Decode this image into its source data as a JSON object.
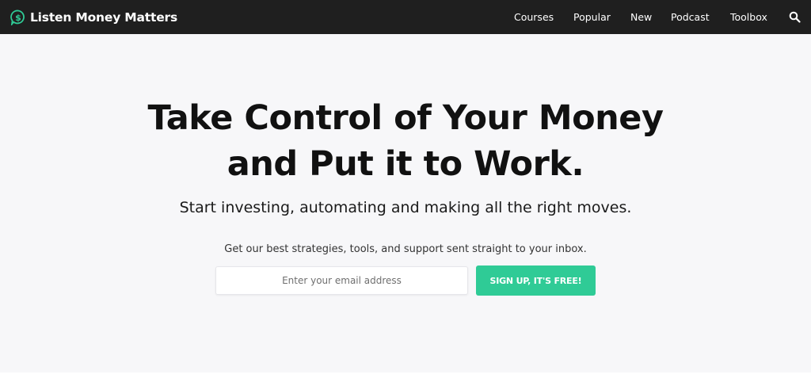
{
  "brand": {
    "name": "Listen Money Matters",
    "accent_color": "#2fcb96",
    "icon": "dollar-chat-bubble-icon"
  },
  "nav": {
    "items": [
      {
        "label": "Courses"
      },
      {
        "label": "Popular"
      },
      {
        "label": "New"
      },
      {
        "label": "Podcast"
      },
      {
        "label": "Toolbox"
      }
    ],
    "search_icon": "search-icon"
  },
  "hero": {
    "headline_line1": "Take Control of Your Money",
    "headline_line2": "and Put it to Work.",
    "subheadline": "Start investing, automating and making all the right moves.",
    "promo_text": "Get our best strategies, tools, and support sent straight to your inbox.",
    "email_placeholder": "Enter your email address",
    "signup_label": "SIGN UP, IT'S FREE!",
    "button_color": "#2fcb96"
  }
}
